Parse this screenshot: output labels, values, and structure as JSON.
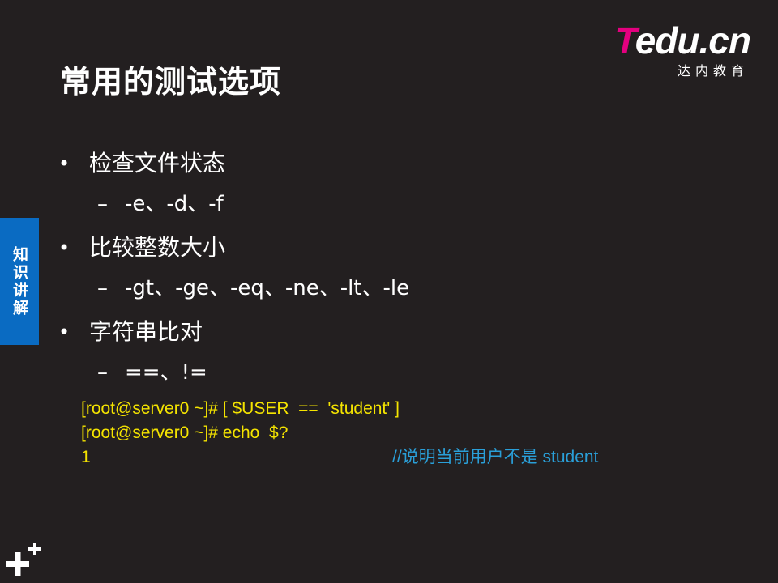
{
  "logo": {
    "brand_first": "T",
    "brand_rest": "edu.cn",
    "subtitle": "达内教育"
  },
  "slide": {
    "title": "常用的测试选项",
    "side_tab": "知识讲解"
  },
  "bullets": [
    {
      "text": "检查文件状态",
      "sub": "-e、-d、-f"
    },
    {
      "text": "比较整数大小",
      "sub": "-gt、-ge、-eq、-ne、-lt、-le"
    },
    {
      "text": "字符串比对",
      "sub": "==、!="
    }
  ],
  "bullet_marker": "•",
  "sub_marker": "–",
  "code": {
    "line1": "[root@server0 ~]# [ $USER  ==  'student' ]",
    "line2": "[root@server0 ~]# echo  $?",
    "line3": "1",
    "comment": "//说明当前用户不是 student"
  },
  "colors": {
    "background": "#231f20",
    "code_text": "#f5e400",
    "comment": "#2a9fd8",
    "side_tab": "#0a6bc2",
    "brand_pink": "#e4007f"
  },
  "icons": {
    "corner": "plus-mark-icon"
  }
}
